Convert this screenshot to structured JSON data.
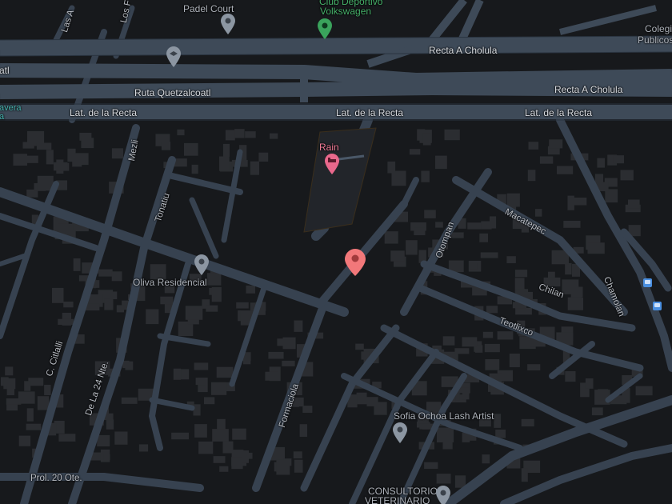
{
  "map": {
    "roads": {
      "recta_a_cholula_top": "Recta A Cholula",
      "recta_a_cholula_bottom": "Recta A Cholula",
      "ruta_quetzalcoatl": "Ruta Quetzalcoatl",
      "lat_recta_left": "Lat. de la Recta",
      "lat_recta_center": "Lat. de la Recta",
      "lat_recta_right": "Lat. de la Recta",
      "edge_left_fragment": "atl"
    },
    "streets": {
      "las": "Las A",
      "los": "Los F",
      "mezli": "Mezli",
      "tonatiuh": "Tonatiu",
      "otompan": "Otompan",
      "macatepec": "Macatepec",
      "chamolan": "Chamolan",
      "chilan": "Chilan",
      "teotlixco": "Teotlixco",
      "c_citlalli": "C. Citlalli",
      "de_la_24": "De La 24 Nte.",
      "formaciola": "Formaciola",
      "prol_20": "Prol. 20 Ote."
    },
    "places": {
      "padel_court": "Padel Court",
      "club_line1": "Club Deportivo",
      "club_line2": "Volkswagen",
      "colegio_line1": "Colegio",
      "colegio_line2": "Publicos",
      "rain": "Rain",
      "oliva": "Oliva Residencial",
      "sofia": "Sofia Ochoa Lash Artist",
      "consultorio_line1": "CONSULTORIO",
      "consultorio_line2": "VETERINARIO",
      "left_edge_line1": "avera",
      "left_edge_line2": "a"
    },
    "icons": {
      "pin_gray": "gray-place-pin",
      "pin_green": "green-sport-pin",
      "pin_pink_hotel": "pink-hotel-pin",
      "pin_red_location": "red-location-pin",
      "pin_school": "school-pin",
      "bus_stop": "bus-stop-icon"
    },
    "colors": {
      "background": "#17191c",
      "building": "#2b2d31",
      "road": "#3a4654",
      "highway": "#3e4a58",
      "highway_edge": "#2a3440",
      "label": "#c9ccd1",
      "poi_green": "#46b06a",
      "poi_pink": "#f07a96",
      "selected_pin": "#f2787a",
      "bus_icon": "#4a8fe0"
    }
  }
}
